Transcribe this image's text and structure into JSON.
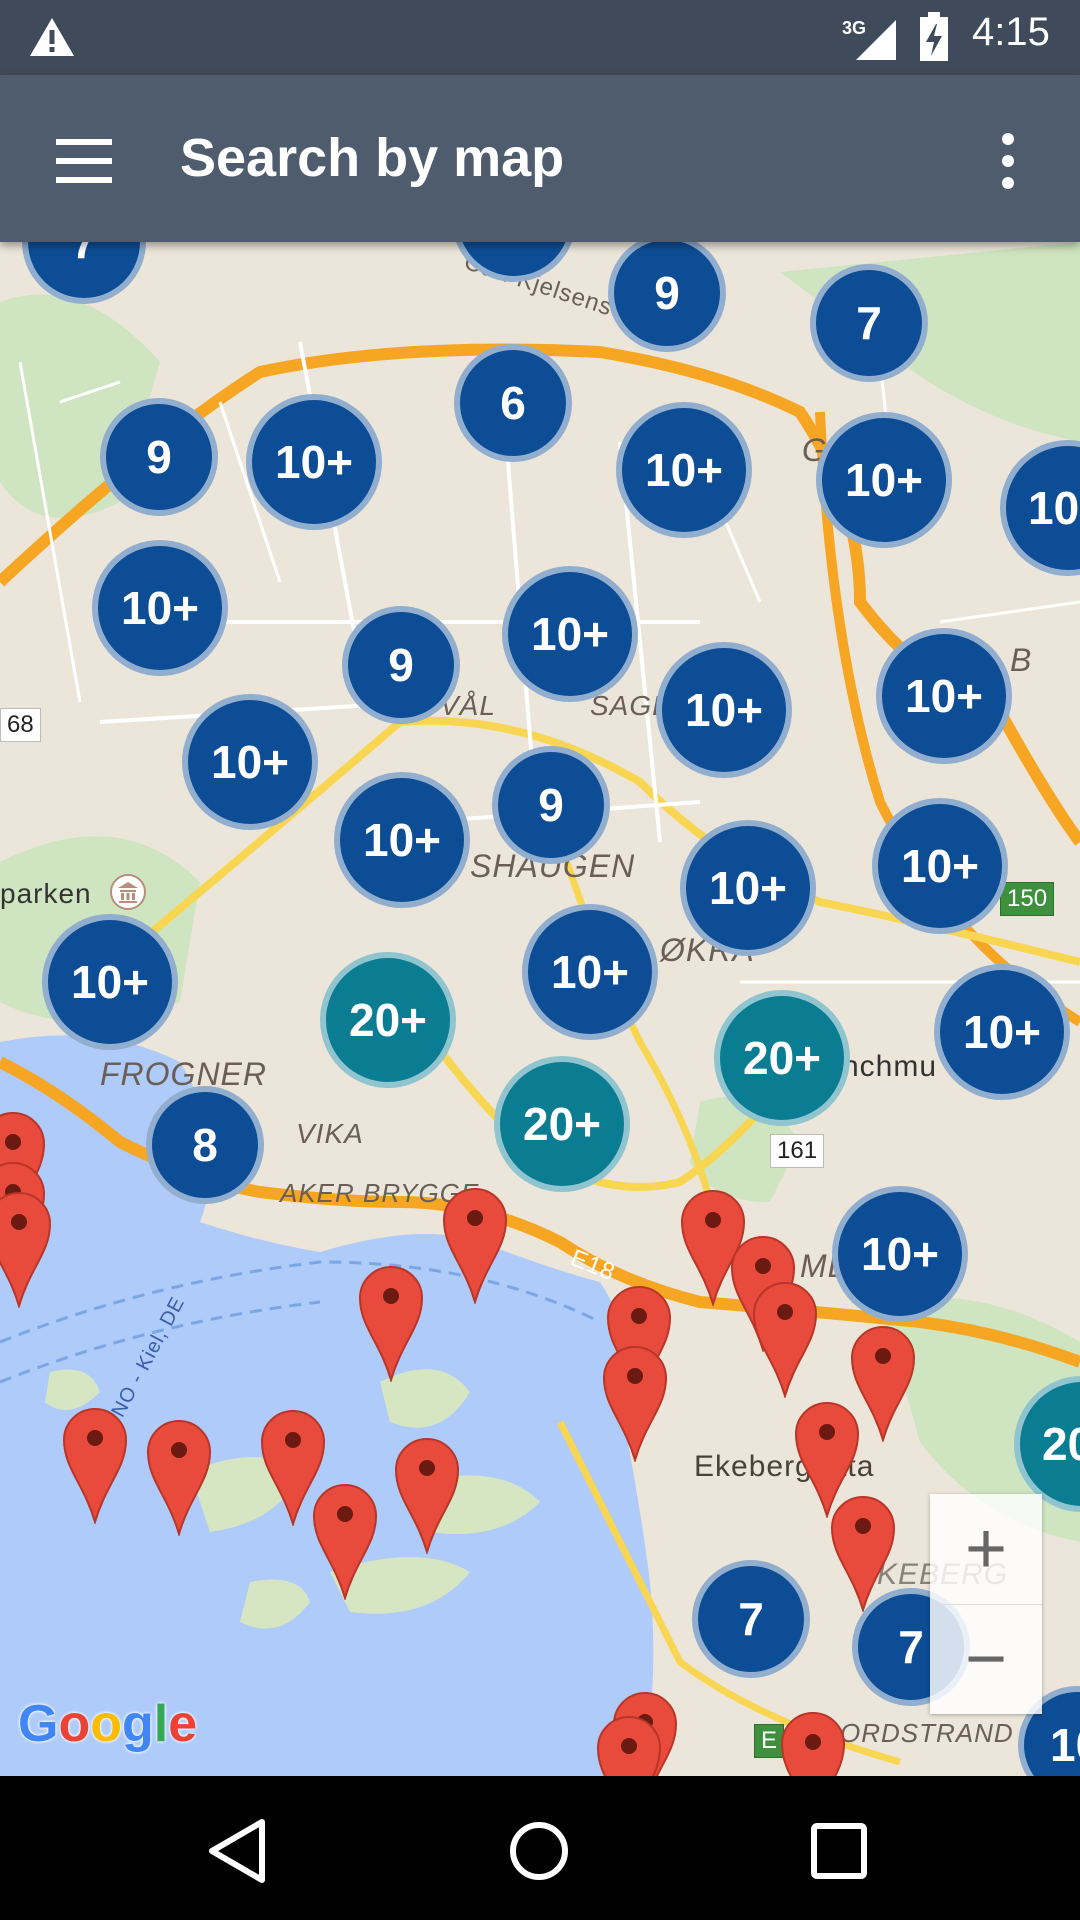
{
  "status_bar": {
    "network": "3G",
    "time": "4:15"
  },
  "app_bar": {
    "title": "Search by map",
    "menu_icon": "hamburger-menu-icon",
    "more_icon": "more-vert-icon"
  },
  "map": {
    "place_labels": [
      "Carl Kjelsens Vei",
      "SAGENE",
      "VÅL",
      "SHAUGEN",
      "ØKRA",
      "FROGNER",
      "VIKA",
      "AKER BRYGGE",
      "Ekebergletta",
      "EKEBERG",
      "ORDSTRAND",
      "parken",
      "nchmu",
      "Oslo, NO - Kiel, DE",
      "E18",
      "G",
      "B",
      "MLE"
    ],
    "road_shields": [
      "68",
      "161",
      "150",
      "E18",
      "E"
    ],
    "clusters": [
      "7",
      "6",
      "9",
      "7",
      "9",
      "10+",
      "6",
      "10+",
      "10+",
      "10",
      "10+",
      "9",
      "10+",
      "10+",
      "10+",
      "10+",
      "9",
      "10+",
      "10+",
      "10+",
      "10+",
      "20+",
      "10+",
      "20+",
      "10+",
      "8",
      "20+",
      "10+",
      "20",
      "7",
      "7",
      "10"
    ],
    "colors": {
      "cluster_blue": "#0d4d96",
      "cluster_teal": "#0b7d93",
      "pin_red": "#e84b3c",
      "water": "#aecbfa",
      "highway": "#f6a623",
      "major_road": "#f8d652"
    }
  },
  "zoom": {
    "in_label": "+",
    "out_label": "−"
  },
  "google_logo": {
    "text": "Google"
  },
  "nav_bar": {
    "back_icon": "back-icon",
    "home_icon": "home-icon",
    "recents_icon": "recents-icon"
  }
}
